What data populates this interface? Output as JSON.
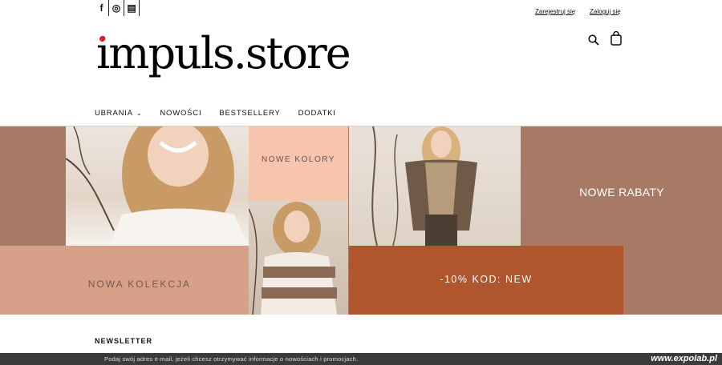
{
  "topbar": {
    "social": [
      {
        "icon": "facebook-icon",
        "glyph": "f"
      },
      {
        "icon": "instagram-icon",
        "glyph": "◎"
      },
      {
        "icon": "newsletter-icon",
        "glyph": "▤"
      }
    ],
    "register_label": "Zarejestruj się",
    "login_label": "Zaloguj się"
  },
  "logo": {
    "text": "impuls.store",
    "dot_color": "#e31b23"
  },
  "header_icons": [
    "search-icon",
    "shopping-bag-icon"
  ],
  "nav": {
    "items": [
      {
        "label": "UBRANIA",
        "has_dropdown": true
      },
      {
        "label": "NOWOŚCI"
      },
      {
        "label": "BESTSELLERY"
      },
      {
        "label": "DODATKI"
      }
    ]
  },
  "banner": {
    "peach_label": "NOWE KOLORY",
    "right_label": "NOWE RABATY",
    "left_label": "NOWA KOLEKCJA",
    "promo_label": "-10% KOD: NEW",
    "colors": {
      "background": "#a77a66",
      "peach": "#f7c4ad",
      "rose": "#d6a089",
      "rust": "#b0562f"
    }
  },
  "newsletter": {
    "heading": "NEWSLETTER",
    "hint": "Podaj swój adres e-mail, jeżeli chcesz otrzymywać informacje o nowościach i promocjach."
  },
  "watermark": "www.expolab.pl"
}
